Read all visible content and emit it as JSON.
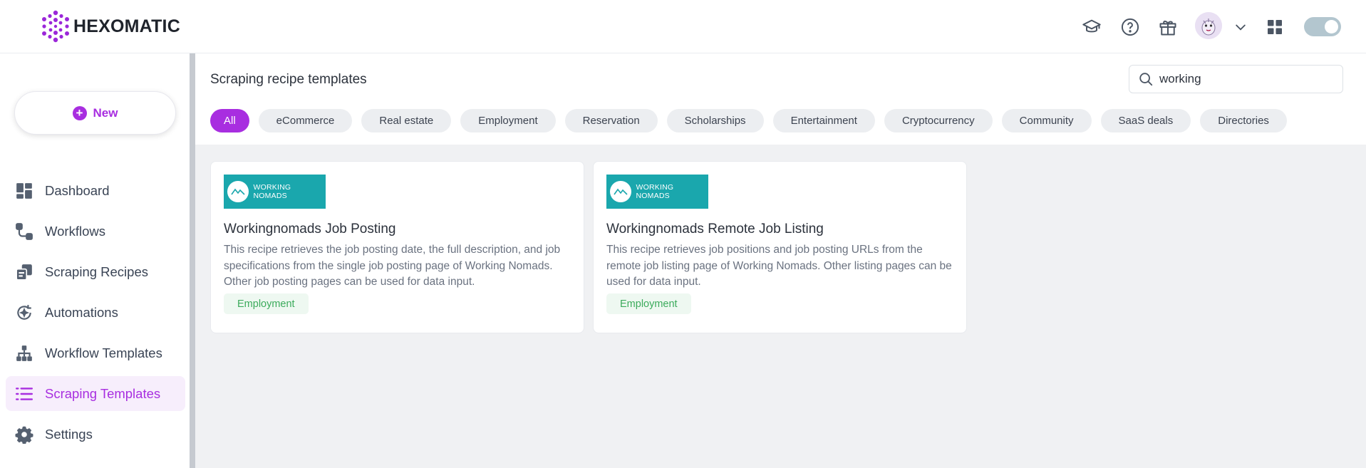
{
  "header": {
    "logo_text": "HEXOMATIC",
    "icons": [
      "academy-icon",
      "help-icon",
      "gift-icon",
      "chevron-down-icon",
      "apps-grid-icon"
    ]
  },
  "sidebar": {
    "new_label": "New",
    "items": [
      {
        "label": "Dashboard",
        "icon": "dashboard-icon"
      },
      {
        "label": "Workflows",
        "icon": "workflows-icon"
      },
      {
        "label": "Scraping Recipes",
        "icon": "recipes-icon"
      },
      {
        "label": "Automations",
        "icon": "automations-icon"
      },
      {
        "label": "Workflow Templates",
        "icon": "workflow-templates-icon"
      },
      {
        "label": "Scraping Templates",
        "icon": "scraping-templates-icon",
        "active": true
      },
      {
        "label": "Settings",
        "icon": "settings-icon"
      }
    ]
  },
  "main": {
    "title": "Scraping recipe templates",
    "search": {
      "value": "working"
    },
    "categories": [
      "All",
      "eCommerce",
      "Real estate",
      "Employment",
      "Reservation",
      "Scholarships",
      "Entertainment",
      "Cryptocurrency",
      "Community",
      "SaaS deals",
      "Directories"
    ],
    "active_category": "All",
    "cards": [
      {
        "logo_text": "WORKING NOMADS",
        "title": "Workingnomads Job Posting",
        "description": "This recipe retrieves the job posting date, the full description, and job specifications from the single job posting page of Working Nomads. Other job posting pages can be used for data input.",
        "tag": "Employment"
      },
      {
        "logo_text": "WORKING NOMADS",
        "title": "Workingnomads Remote Job Listing",
        "description": "This recipe retrieves job positions and job posting URLs from the remote job listing page of Working Nomads. Other listing pages can be used for data input.",
        "tag": "Employment"
      }
    ]
  },
  "colors": {
    "accent": "#a82ee0",
    "tag_green": "#3cab5c",
    "brand_teal": "#1aa7ad"
  }
}
